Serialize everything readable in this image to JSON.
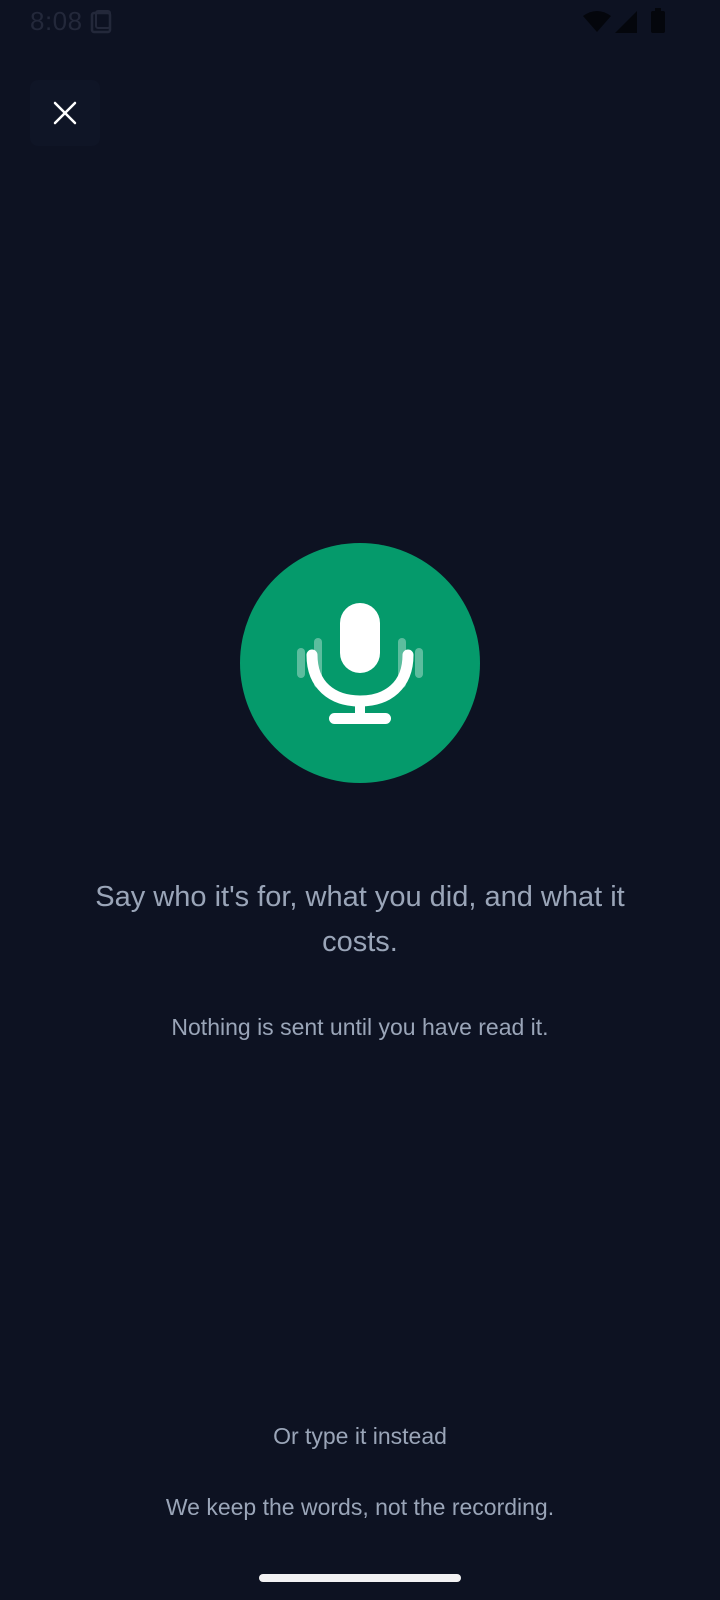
{
  "status_bar": {
    "time": "8:08",
    "icons": [
      "sim-card-icon",
      "wifi-icon",
      "cell-signal-icon",
      "battery-icon"
    ]
  },
  "close_button": {
    "icon": "close-icon"
  },
  "mic": {
    "icon": "microphone-icon",
    "color": "#059a6b"
  },
  "prompt": {
    "title": "Say who it's for, what you did, and what it costs.",
    "subtitle": "Nothing is sent until you have read it."
  },
  "type_instead_label": "Or type it instead",
  "privacy_note": "We keep the words, not the recording.",
  "colors": {
    "background": "#0d1222",
    "text": "#9aa5b8",
    "accent": "#059a6b"
  }
}
